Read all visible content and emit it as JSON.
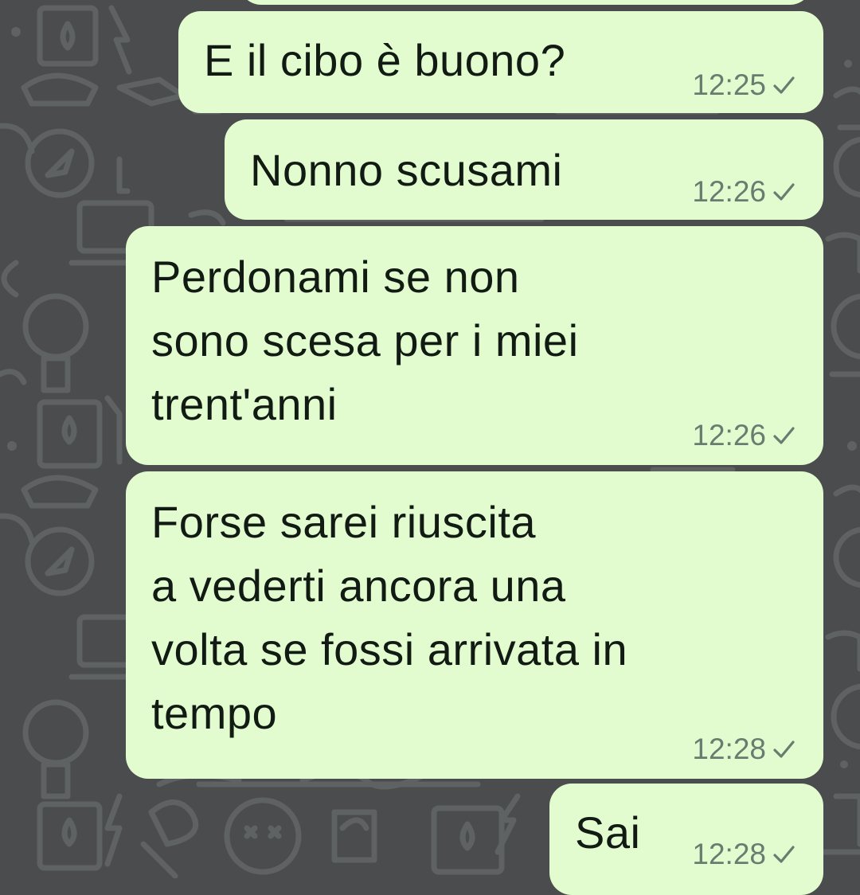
{
  "colors": {
    "outgoing_bubble": "#e2fccf",
    "wallpaper": "#4a4c4d",
    "timestamp": "#6a7c70",
    "text": "#111b14"
  },
  "messages": [
    {
      "text": "E il cibo è buono?",
      "time": "12:25",
      "status": "sent-check-icon"
    },
    {
      "text": "Nonno scusami",
      "time": "12:26",
      "status": "sent-check-icon"
    },
    {
      "text": "Perdonami se non\nsono scesa per i miei\ntrent'anni",
      "time": "12:26",
      "status": "sent-check-icon"
    },
    {
      "text": "Forse sarei riuscita\na vederti ancora una\nvolta se fossi arrivata in\ntempo",
      "time": "12:28",
      "status": "sent-check-icon"
    },
    {
      "text": "Sai",
      "time": "12:28",
      "status": "sent-check-icon"
    }
  ]
}
